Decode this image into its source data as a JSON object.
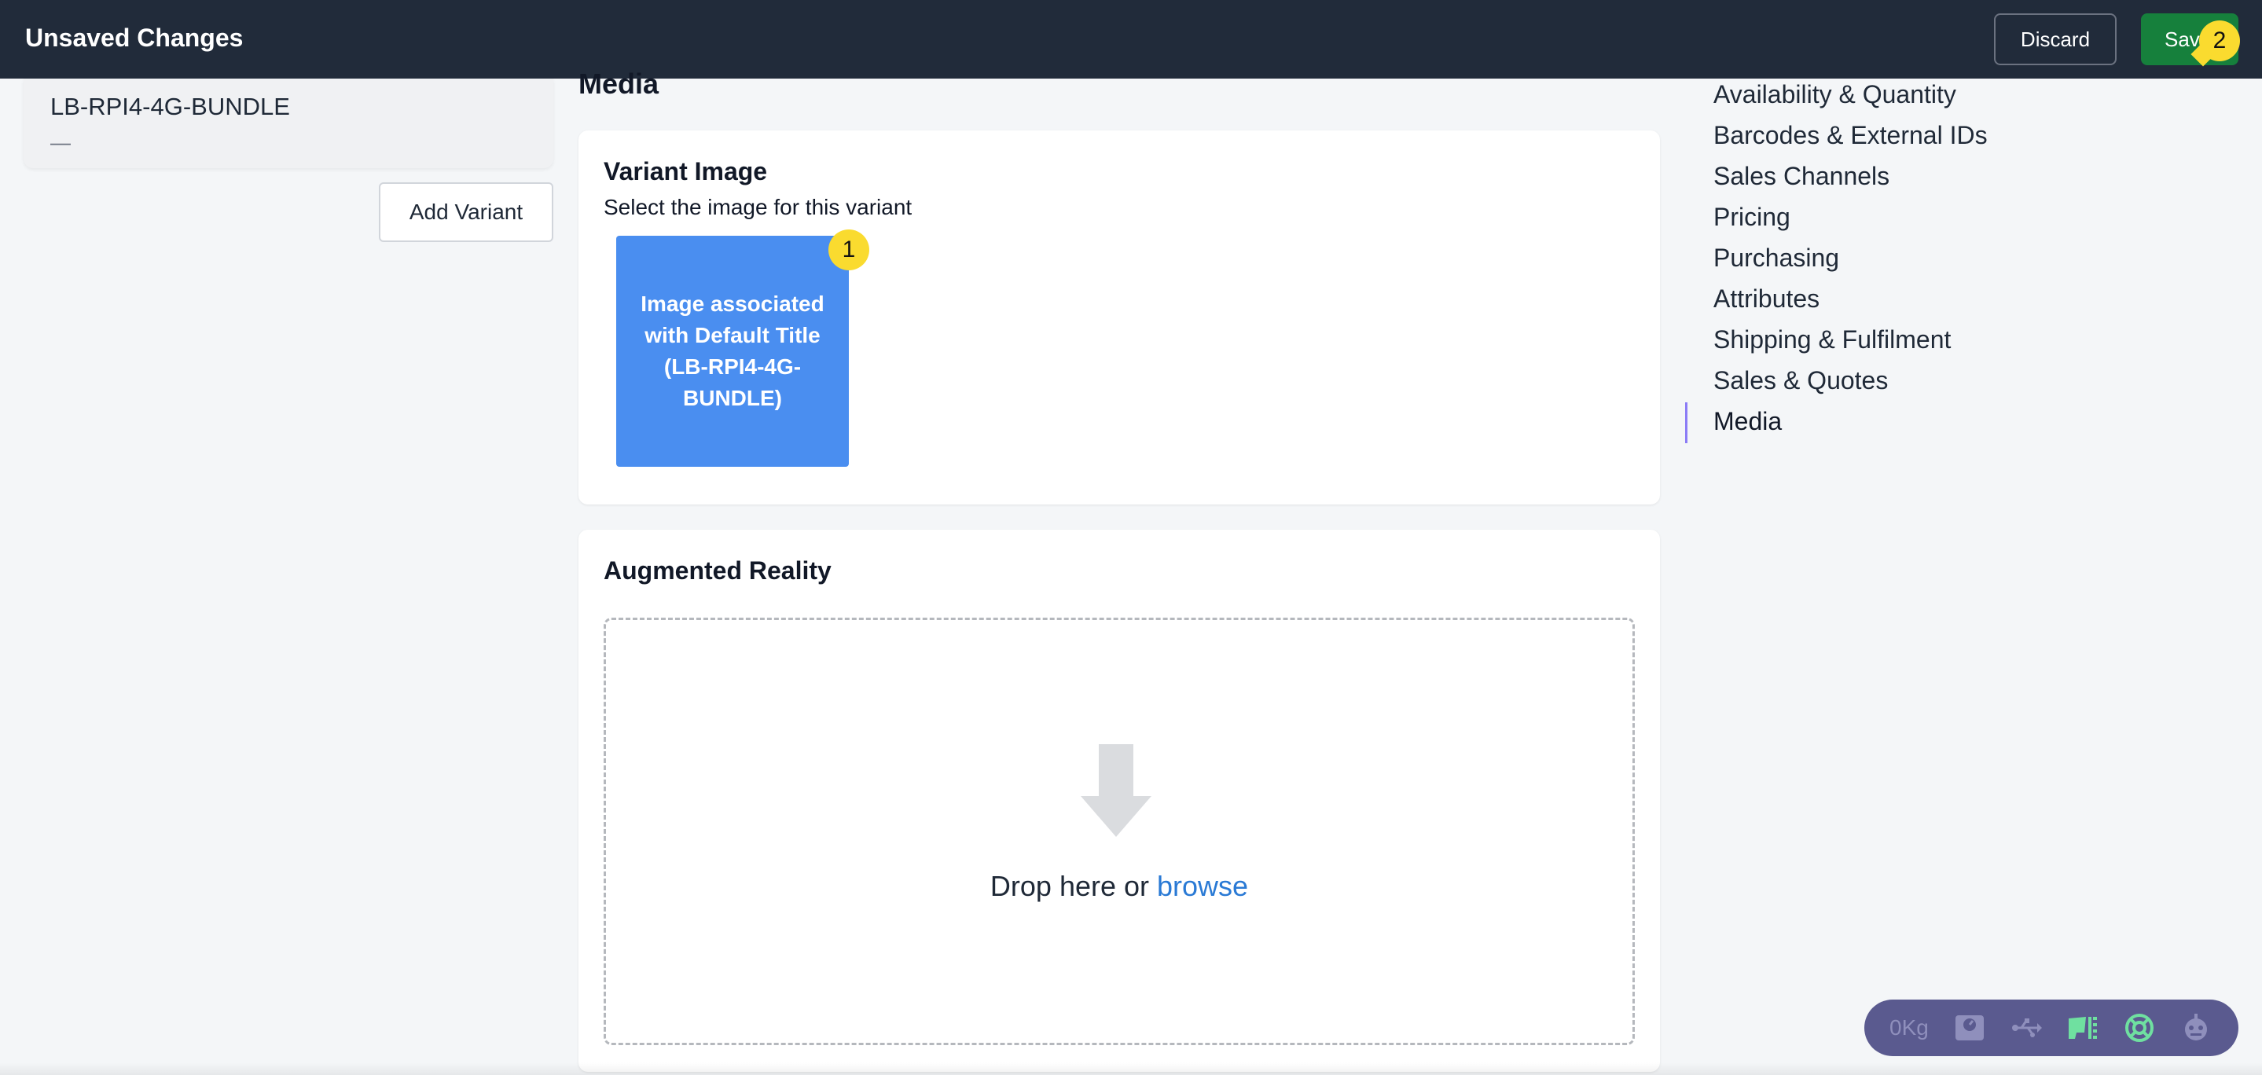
{
  "topbar": {
    "title": "Unsaved Changes",
    "discard_label": "Discard",
    "save_label": "Save",
    "save_badge": "2"
  },
  "variant": {
    "sku": "LB-RPI4-4G-BUNDLE",
    "subtitle": "—",
    "add_label": "Add Variant"
  },
  "section": {
    "title": "Media"
  },
  "variant_image": {
    "title": "Variant Image",
    "subtitle": "Select the image for this variant",
    "image_label": "Image associated with Default Title (LB-RPI4-4G-BUNDLE)",
    "badge": "1"
  },
  "augmented_reality": {
    "title": "Augmented Reality",
    "drop_text": "Drop here or ",
    "browse_label": "browse"
  },
  "nav": {
    "items": [
      {
        "label": "Availability & Quantity"
      },
      {
        "label": "Barcodes & External IDs"
      },
      {
        "label": "Sales Channels"
      },
      {
        "label": "Pricing"
      },
      {
        "label": "Purchasing"
      },
      {
        "label": "Attributes"
      },
      {
        "label": "Shipping & Fulfilment"
      },
      {
        "label": "Sales & Quotes"
      },
      {
        "label": "Media"
      }
    ],
    "active": "Media"
  },
  "toolbar": {
    "weight": "0Kg",
    "icons": [
      "scale-icon",
      "usb-icon",
      "printer-icon",
      "help-ring-icon",
      "robot-icon"
    ]
  },
  "colors": {
    "topbar_bg": "#212b3a",
    "save_bg": "#16803c",
    "badge": "#fadb2f",
    "image_tile": "#4a8ef0",
    "link": "#2a7ad5",
    "active_nav": "#8b7cf6"
  }
}
